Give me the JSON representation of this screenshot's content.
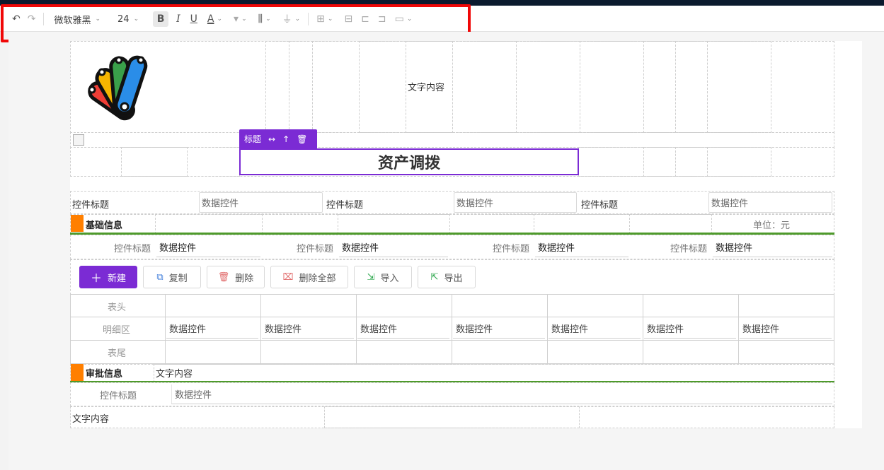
{
  "toolbar": {
    "undo_icon": "undo-icon",
    "redo_icon": "redo-icon",
    "font_family": "微软雅黑",
    "font_size": "24",
    "bold": "B",
    "italic": "I",
    "underline": "U",
    "font_color": "A",
    "accent_color": "#f00707"
  },
  "header": {
    "logo": "peacock-fan-logo",
    "text_content": "文字内容"
  },
  "title": {
    "toolbar_label": "标题",
    "text": "资产调拨"
  },
  "form_row": {
    "cells": [
      {
        "label": "控件标题",
        "value": "数据控件"
      },
      {
        "label": "控件标题",
        "value": "数据控件"
      },
      {
        "label": "控件标题",
        "value": "数据控件"
      }
    ]
  },
  "basic_info": {
    "title": "基础信息",
    "unit": "单位：元",
    "fields": [
      {
        "label": "控件标题",
        "value": "数据控件"
      },
      {
        "label": "控件标题",
        "value": "数据控件"
      },
      {
        "label": "控件标题",
        "value": "数据控件"
      },
      {
        "label": "控件标题",
        "value": "数据控件"
      }
    ]
  },
  "actions": {
    "new": "新建",
    "copy": "复制",
    "delete": "删除",
    "delete_all": "删除全部",
    "import": "导入",
    "export": "导出"
  },
  "detail_table": {
    "row_labels": [
      "表头",
      "明细区",
      "表尾"
    ],
    "cells": [
      "数据控件",
      "数据控件",
      "数据控件",
      "数据控件",
      "数据控件",
      "数据控件",
      "数据控件"
    ]
  },
  "approval": {
    "title": "审批信息",
    "text": "文字内容",
    "field_label": "控件标题",
    "field_value": "数据控件",
    "footer_text": "文字内容"
  },
  "colors": {
    "primary": "#7b2bd4",
    "section_accent": "#ff7f00",
    "divider": "#4e9a2b"
  }
}
